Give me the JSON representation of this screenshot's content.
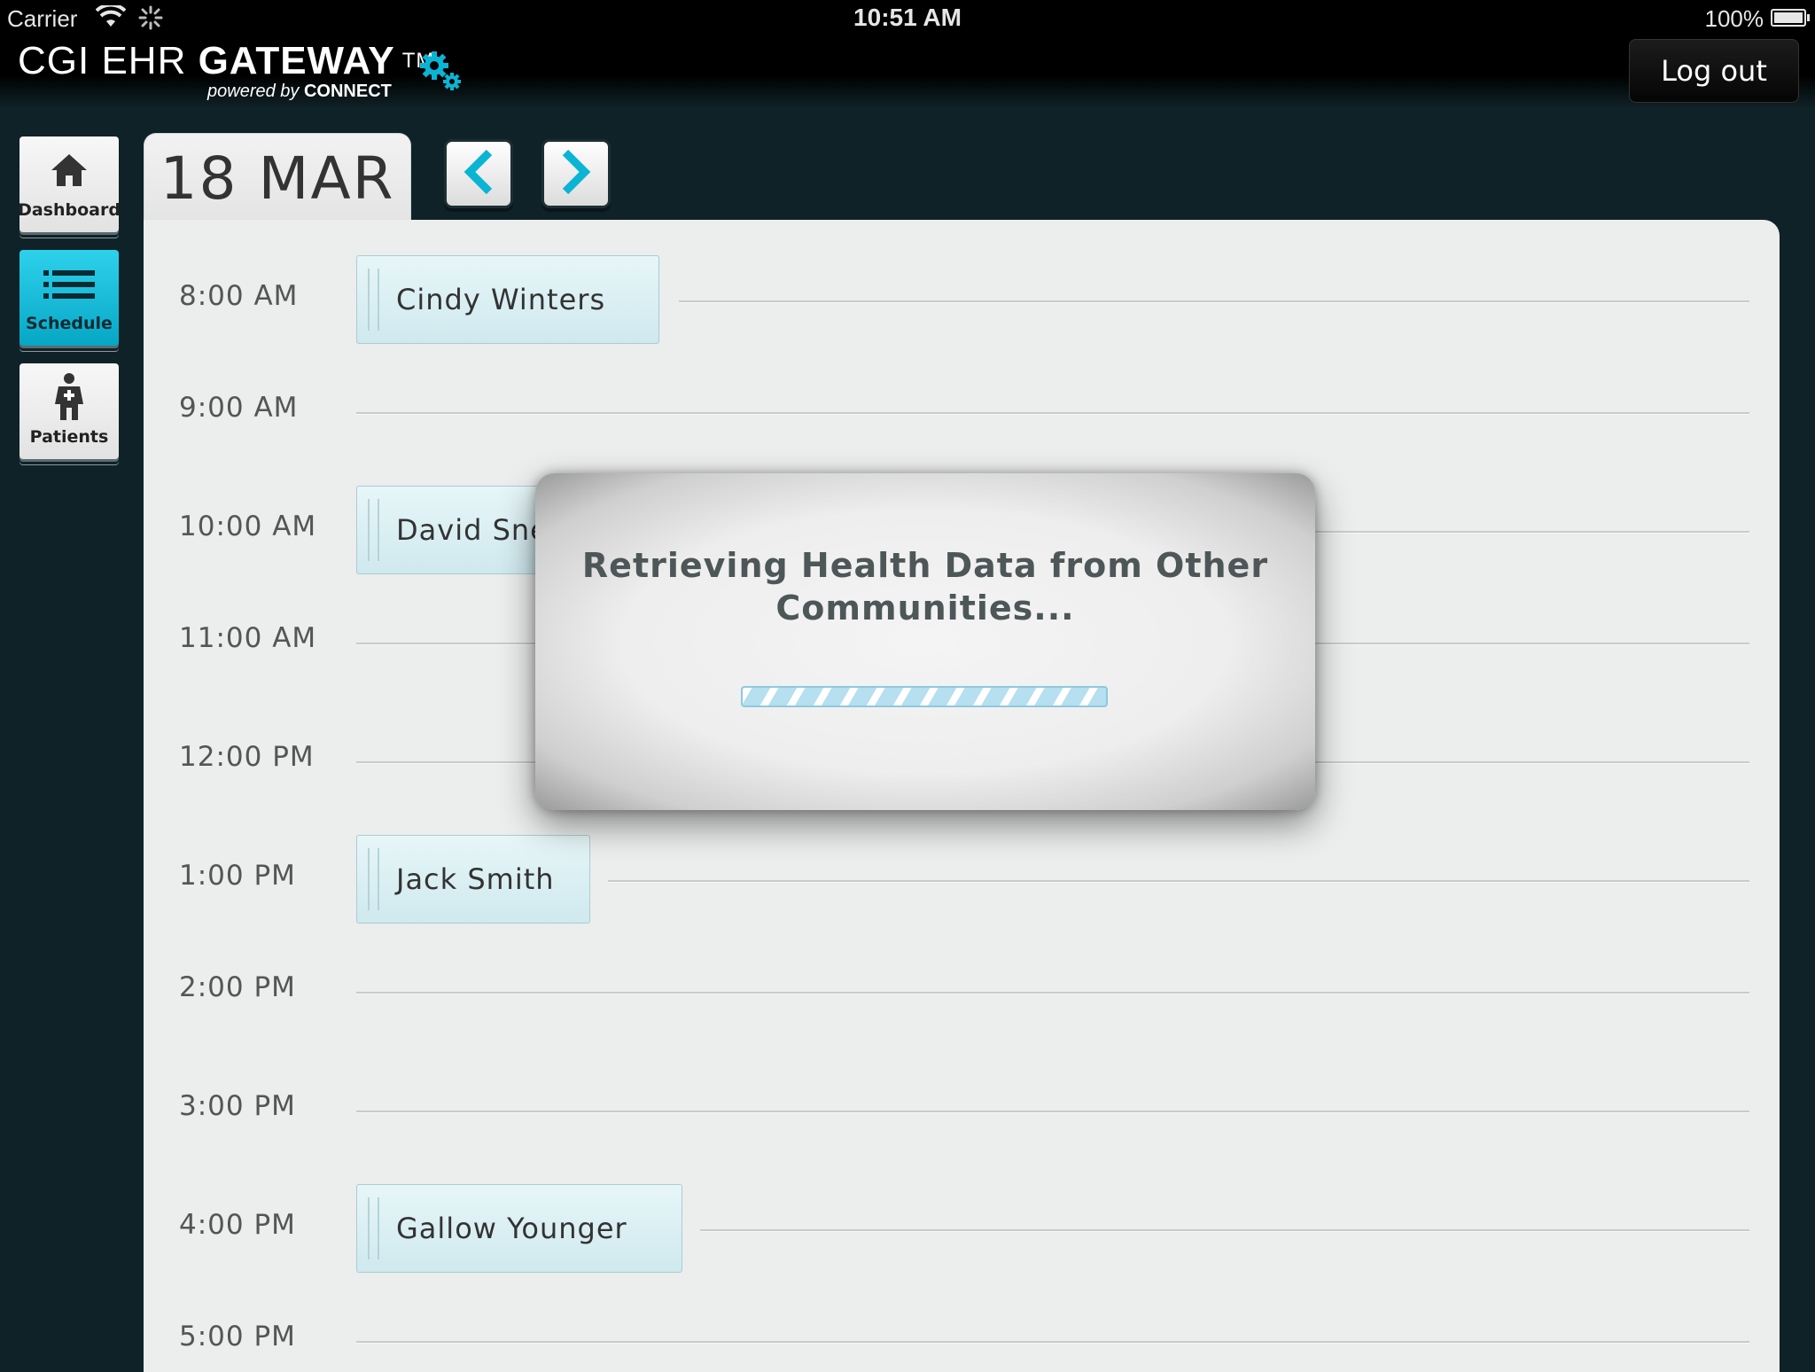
{
  "status_bar": {
    "carrier": "Carrier",
    "time": "10:51 AM",
    "battery": "100%"
  },
  "header": {
    "brand_light": "CGI EHR ",
    "brand_bold": "GATEWAY",
    "brand_tm": "TM",
    "powered_by": "powered by ",
    "powered_by_brand": "CONNECT",
    "logout_label": "Log out"
  },
  "nav": {
    "items": [
      {
        "label": "Dashboard",
        "icon": "home-icon"
      },
      {
        "label": "Schedule",
        "icon": "list-icon",
        "active": true
      },
      {
        "label": "Patients",
        "icon": "patient-icon"
      }
    ]
  },
  "date_header": {
    "date": "18 MAR"
  },
  "schedule": {
    "slots": [
      {
        "time": "8:00 AM",
        "patient": "Cindy Winters"
      },
      {
        "time": "9:00 AM",
        "patient": null
      },
      {
        "time": "10:00 AM",
        "patient": "David Sne"
      },
      {
        "time": "11:00 AM",
        "patient": null
      },
      {
        "time": "12:00 PM",
        "patient": null
      },
      {
        "time": "1:00 PM",
        "patient": "Jack Smith"
      },
      {
        "time": "2:00 PM",
        "patient": null
      },
      {
        "time": "3:00 PM",
        "patient": null
      },
      {
        "time": "4:00 PM",
        "patient": "Gallow Younger"
      },
      {
        "time": "5:00 PM",
        "patient": null
      }
    ]
  },
  "modal": {
    "message": "Retrieving Health Data from Other Communities..."
  },
  "colors": {
    "accent": "#0ab4d4",
    "background": "#0f2227",
    "panel": "#eceded"
  }
}
